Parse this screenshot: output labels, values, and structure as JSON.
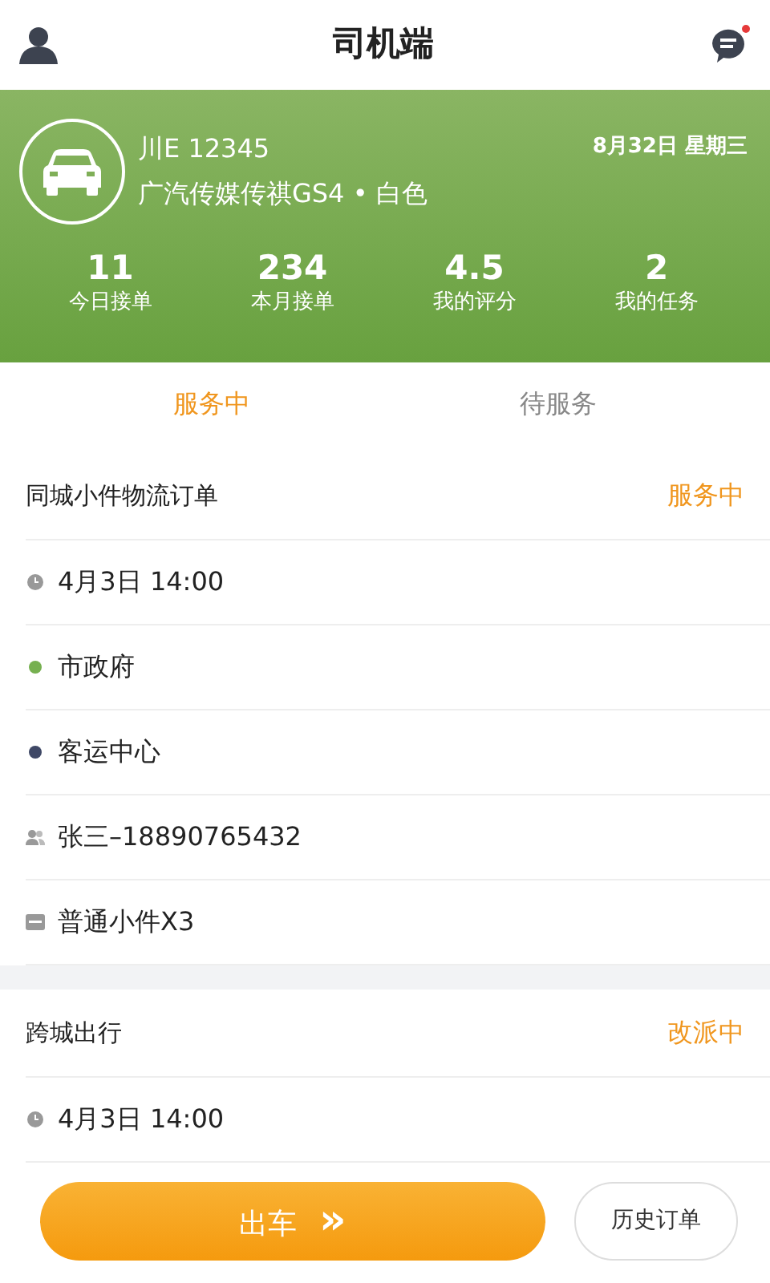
{
  "header": {
    "title": "司机端",
    "unread": true
  },
  "vehicle": {
    "plate": "川E 12345",
    "model": "广汽传媒传祺GS4 • 白色",
    "date": "8月32日 星期三"
  },
  "stats": [
    {
      "value": "11",
      "label": "今日接单"
    },
    {
      "value": "234",
      "label": "本月接单"
    },
    {
      "value": "4.5",
      "label": "我的评分"
    },
    {
      "value": "2",
      "label": "我的任务"
    }
  ],
  "tabs": [
    {
      "label": "服务中",
      "selected": true
    },
    {
      "label": "待服务",
      "selected": false
    }
  ],
  "orders": [
    {
      "title": "同城小件物流订单",
      "status": "服务中",
      "rows": [
        {
          "kind": "time",
          "text": "4月3日 14:00"
        },
        {
          "kind": "start",
          "text": "市政府"
        },
        {
          "kind": "end",
          "text": "客运中心"
        },
        {
          "kind": "contact",
          "text": "张三–18890765432"
        },
        {
          "kind": "cargo",
          "text": "普通小件X3"
        }
      ]
    },
    {
      "title": "跨城出行",
      "status": "改派中",
      "rows": [
        {
          "kind": "time",
          "text": "4月3日 14:00"
        }
      ]
    }
  ],
  "actions": {
    "primary": "出车",
    "primary_icon": "»",
    "secondary": "历史订单"
  }
}
